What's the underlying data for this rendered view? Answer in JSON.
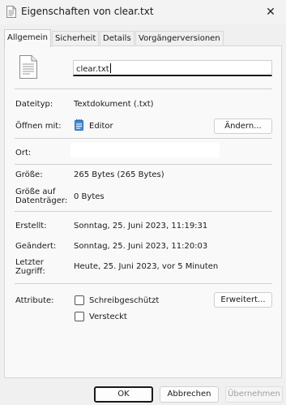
{
  "window": {
    "title": "Eigenschaften von clear.txt",
    "close_symbol": "✕"
  },
  "tabs": [
    {
      "label": "Allgemein",
      "active": true
    },
    {
      "label": "Sicherheit",
      "active": false
    },
    {
      "label": "Details",
      "active": false
    },
    {
      "label": "Vorgängerversionen",
      "active": false
    }
  ],
  "general": {
    "file_name": "clear.txt",
    "type_label": "Dateityp:",
    "type_value": "Textdokument (.txt)",
    "opens_with_label": "Öffnen mit:",
    "opens_with_value": "Editor",
    "change_button": "Ändern...",
    "location_label": "Ort:",
    "location_value": "",
    "size_label": "Größe:",
    "size_value": "265 Bytes (265 Bytes)",
    "size_on_disk_label_line1": "Größe auf",
    "size_on_disk_label_line2": "Datenträger:",
    "size_on_disk_value": "0 Bytes",
    "created_label": "Erstellt:",
    "created_value": "Sonntag, 25. Juni 2023, 11:19:31",
    "modified_label": "Geändert:",
    "modified_value": "Sonntag, 25. Juni 2023, 11:20:03",
    "accessed_label_line1": "Letzter",
    "accessed_label_line2": "Zugriff:",
    "accessed_value": "Heute, 25. Juni 2023, vor 5 Minuten",
    "attributes_label": "Attribute:",
    "readonly_label": "Schreibgeschützt",
    "readonly_checked": false,
    "hidden_label": "Versteckt",
    "hidden_checked": false,
    "advanced_button": "Erweitert..."
  },
  "footer": {
    "ok": "OK",
    "cancel": "Abbrechen",
    "apply": "Übernehmen"
  },
  "colors": {
    "window_bg": "#f0f0f0",
    "panel_bg": "#f9f9f9",
    "editor_icon": "#4a90d9",
    "disabled_text": "#a0a0a0"
  }
}
